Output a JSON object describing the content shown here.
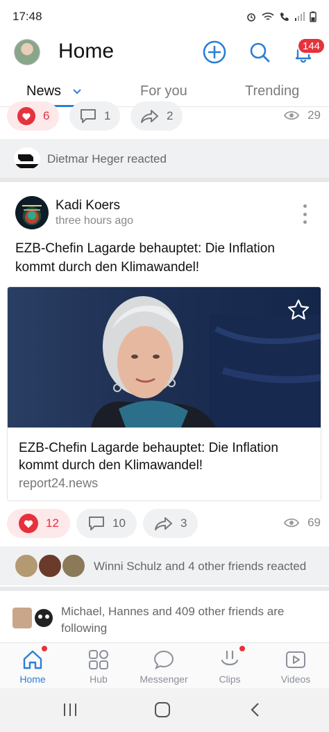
{
  "status_bar": {
    "time": "17:48"
  },
  "header": {
    "title": "Home",
    "notification_count": "144"
  },
  "tabs": [
    {
      "label": "News"
    },
    {
      "label": "For you"
    },
    {
      "label": "Trending"
    }
  ],
  "prev_post": {
    "likes": "6",
    "comments": "1",
    "shares": "2",
    "views": "29"
  },
  "prev_reaction": {
    "text": "Dietmar Heger reacted"
  },
  "post": {
    "author": "Kadi Koers",
    "time": "three hours ago",
    "text": "EZB-Chefin Lagarde behauptet: Die Inflation kommt durch den Klimawandel!",
    "link": {
      "title": "EZB-Chefin Lagarde behauptet: Die Inflation kommt durch den Klimawandel!",
      "domain": "report24.news"
    },
    "likes": "12",
    "comments": "10",
    "shares": "3",
    "views": "69",
    "reactions_text": "Winni Schulz and 4 other friends reacted"
  },
  "following": {
    "text": "Michael, Hannes and 409 other friends are following"
  },
  "bottom_nav": [
    {
      "label": "Home",
      "icon": "home-icon"
    },
    {
      "label": "Hub",
      "icon": "grid-icon"
    },
    {
      "label": "Messenger",
      "icon": "chat-bubble-icon"
    },
    {
      "label": "Clips",
      "icon": "clips-icon"
    },
    {
      "label": "Videos",
      "icon": "video-play-icon"
    }
  ],
  "colors": {
    "accent": "#2a7fd4",
    "like": "#e5323c",
    "badge": "#e5323c"
  }
}
